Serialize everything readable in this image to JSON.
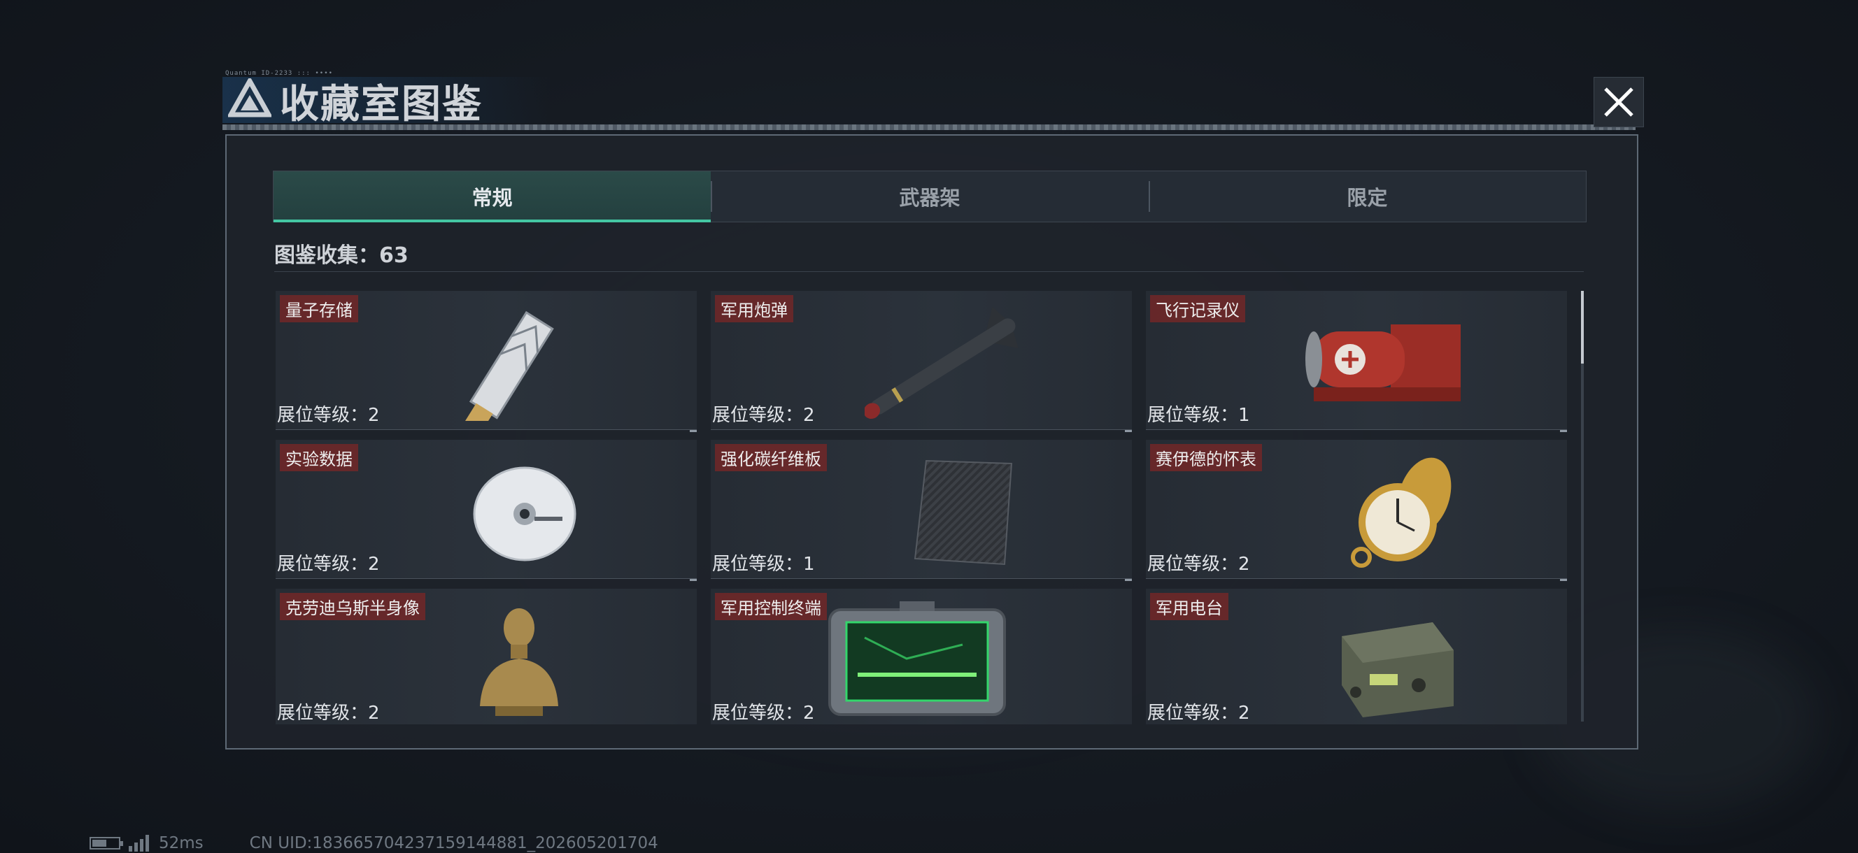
{
  "header": {
    "caption": "Quantum ID-2233 ::: ••••",
    "title": "收藏室图鉴"
  },
  "tabs": [
    {
      "label": "常规",
      "active": true
    },
    {
      "label": "武器架",
      "active": false
    },
    {
      "label": "限定",
      "active": false
    }
  ],
  "collection": {
    "label": "图鉴收集：63"
  },
  "level_label": "展位等级：",
  "items": [
    {
      "name": "量子存储",
      "level": "2",
      "icon": "usb-drive-icon"
    },
    {
      "name": "军用炮弹",
      "level": "2",
      "icon": "missile-icon"
    },
    {
      "name": "飞行记录仪",
      "level": "1",
      "icon": "flight-recorder-icon"
    },
    {
      "name": "实验数据",
      "level": "2",
      "icon": "disc-icon"
    },
    {
      "name": "强化碳纤维板",
      "level": "1",
      "icon": "carbon-plate-icon"
    },
    {
      "name": "赛伊德的怀表",
      "level": "2",
      "icon": "pocket-watch-icon"
    },
    {
      "name": "克劳迪乌斯半身像",
      "level": "2",
      "icon": "bust-icon"
    },
    {
      "name": "军用控制终端",
      "level": "2",
      "icon": "control-terminal-icon"
    },
    {
      "name": "军用电台",
      "level": "2",
      "icon": "radio-icon"
    }
  ],
  "status": {
    "ping": "52ms",
    "uid": "CN UID:183665704237159144881_202605201704"
  },
  "colors": {
    "tab_active_underline": "#44c7a3",
    "tag_background": "#78262679"
  }
}
